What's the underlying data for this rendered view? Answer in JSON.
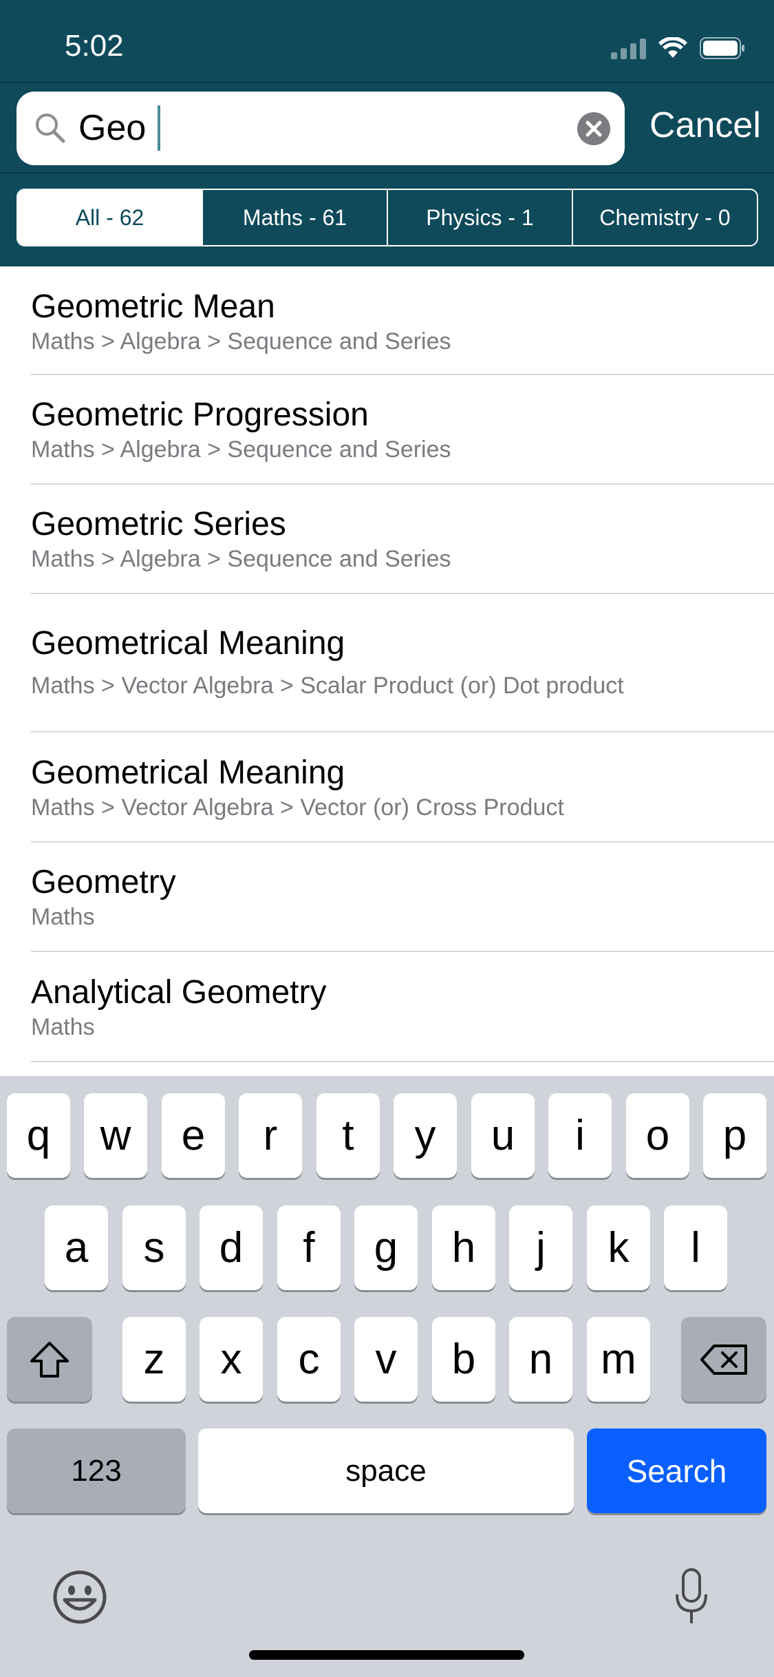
{
  "status_bar": {
    "time": "5:02"
  },
  "search": {
    "value": "Geo",
    "cancel_label": "Cancel"
  },
  "segments": [
    {
      "label": "All - 62"
    },
    {
      "label": "Maths - 61"
    },
    {
      "label": "Physics - 1"
    },
    {
      "label": "Chemistry - 0"
    }
  ],
  "results": [
    {
      "title": "Geometric Mean",
      "path": "Maths > Algebra > Sequence and Series"
    },
    {
      "title": "Geometric Progression",
      "path": "Maths > Algebra > Sequence and Series"
    },
    {
      "title": "Geometric Series",
      "path": "Maths > Algebra > Sequence and Series"
    },
    {
      "title": "Geometrical Meaning",
      "path": "Maths > Vector Algebra > Scalar Product (or) Dot product"
    },
    {
      "title": "Geometrical Meaning",
      "path": "Maths > Vector Algebra > Vector (or) Cross Product"
    },
    {
      "title": "Geometry",
      "path": "Maths"
    },
    {
      "title": "Analytical Geometry",
      "path": "Maths"
    }
  ],
  "keyboard": {
    "row1": [
      "q",
      "w",
      "e",
      "r",
      "t",
      "y",
      "u",
      "i",
      "o",
      "p"
    ],
    "row2": [
      "a",
      "s",
      "d",
      "f",
      "g",
      "h",
      "j",
      "k",
      "l"
    ],
    "row3": [
      "z",
      "x",
      "c",
      "v",
      "b",
      "n",
      "m"
    ],
    "numbers_label": "123",
    "space_label": "space",
    "search_label": "Search"
  },
  "colors": {
    "header": "#0e4a5a",
    "keyboard_bg": "#d0d3d9",
    "search_key": "#0a60ff"
  }
}
